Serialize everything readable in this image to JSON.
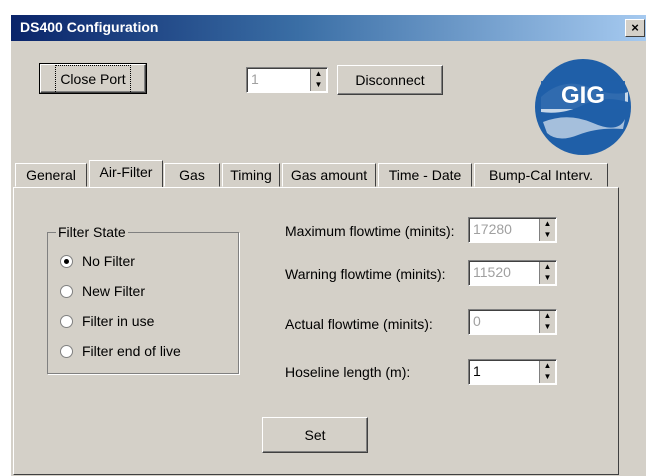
{
  "window": {
    "title": "DS400 Configuration",
    "close_glyph": "×"
  },
  "toolbar": {
    "close_port_label": "Close Port",
    "port_value": "1",
    "disconnect_label": "Disconnect",
    "logo_text": "GIG"
  },
  "tabs": [
    {
      "label": "General"
    },
    {
      "label": "Air-Filter"
    },
    {
      "label": "Gas"
    },
    {
      "label": "Timing"
    },
    {
      "label": "Gas amount"
    },
    {
      "label": "Time - Date"
    },
    {
      "label": "Bump-Cal Interv."
    }
  ],
  "filter_state": {
    "legend": "Filter State",
    "options": [
      {
        "label": "No Filter",
        "selected": true
      },
      {
        "label": "New Filter",
        "selected": false
      },
      {
        "label": "Filter in use",
        "selected": false
      },
      {
        "label": "Filter end of live",
        "selected": false
      }
    ]
  },
  "fields": [
    {
      "label": "Maximum flowtime (minits):",
      "value": "17280",
      "enabled": false
    },
    {
      "label": "Warning flowtime (minits):",
      "value": "11520",
      "enabled": false
    },
    {
      "label": "Actual flowtime (minits):",
      "value": "0",
      "enabled": false
    },
    {
      "label": "Hoseline length (m):",
      "value": "1",
      "enabled": true
    }
  ],
  "set_label": "Set",
  "icons": {
    "spin_up": "▲",
    "spin_down": "▼",
    "radio": "radio-button"
  }
}
